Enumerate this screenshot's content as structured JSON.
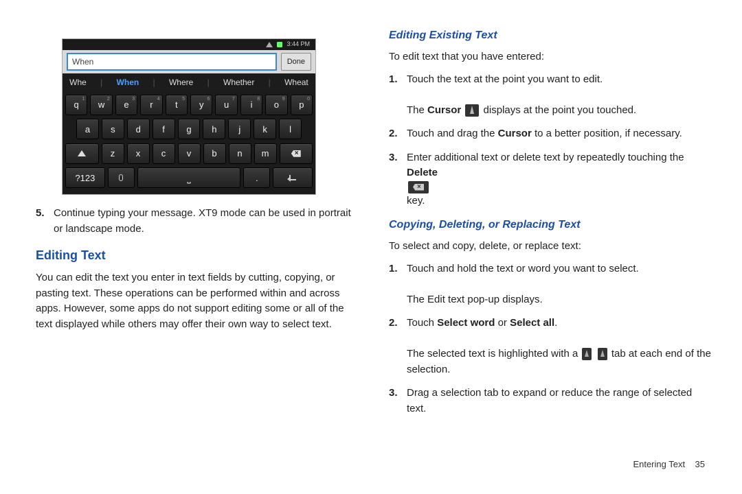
{
  "screenshot": {
    "status_time": "3:44 PM",
    "input_value": "When",
    "done_label": "Done",
    "suggestions": [
      "Whe",
      "When",
      "Where",
      "Whether",
      "Wheat"
    ],
    "active_suggestion_index": 1,
    "rows": {
      "r1": [
        {
          "k": "q",
          "s": "1"
        },
        {
          "k": "w",
          "s": "2"
        },
        {
          "k": "e",
          "s": "3"
        },
        {
          "k": "r",
          "s": "4"
        },
        {
          "k": "t",
          "s": "5"
        },
        {
          "k": "y",
          "s": "6"
        },
        {
          "k": "u",
          "s": "7"
        },
        {
          "k": "i",
          "s": "8"
        },
        {
          "k": "o",
          "s": "9"
        },
        {
          "k": "p",
          "s": "0"
        }
      ],
      "r2": [
        {
          "k": "a"
        },
        {
          "k": "s"
        },
        {
          "k": "d"
        },
        {
          "k": "f"
        },
        {
          "k": "g"
        },
        {
          "k": "h"
        },
        {
          "k": "j"
        },
        {
          "k": "k"
        },
        {
          "k": "l"
        }
      ],
      "r3_letters": [
        {
          "k": "z"
        },
        {
          "k": "x"
        },
        {
          "k": "c"
        },
        {
          "k": "v"
        },
        {
          "k": "b"
        },
        {
          "k": "n"
        },
        {
          "k": "m"
        }
      ],
      "sym_label": "?123",
      "period": "."
    }
  },
  "left": {
    "step5_num": "5.",
    "step5_text": "Continue typing your message. XT9 mode can be used in portrait or landscape mode.",
    "heading": "Editing Text",
    "para": "You can edit the text you enter in text fields by cutting, copying, or pasting text. These operations can be performed within and across apps. However, some apps do not support editing some or all of the text displayed while others may offer their own way to select text."
  },
  "right": {
    "sec1_heading": "Editing Existing Text",
    "sec1_intro": "To edit text that you have entered:",
    "sec1_step1_num": "1.",
    "sec1_step1_text": "Touch the text at the point you want to edit.",
    "sec1_step1_note_a": "The ",
    "sec1_step1_note_b": "Cursor",
    "sec1_step1_note_c": " displays at the point you touched.",
    "sec1_step2_num": "2.",
    "sec1_step2_a": "Touch and drag the ",
    "sec1_step2_b": "Cursor",
    "sec1_step2_c": " to a better position, if necessary.",
    "sec1_step3_num": "3.",
    "sec1_step3_a": "Enter additional text or delete text by repeatedly touching the ",
    "sec1_step3_b": "Delete",
    "sec1_step3_c": " key.",
    "sec2_heading": "Copying, Deleting, or Replacing Text",
    "sec2_intro": "To select and copy, delete, or replace text:",
    "sec2_step1_num": "1.",
    "sec2_step1_text": "Touch and hold the text or word you want to select.",
    "sec2_step1_note": "The Edit text pop-up displays.",
    "sec2_step2_num": "2.",
    "sec2_step2_a": "Touch ",
    "sec2_step2_b": "Select word",
    "sec2_step2_c": " or ",
    "sec2_step2_d": "Select all",
    "sec2_step2_e": ".",
    "sec2_step2_note_a": "The selected text is highlighted with a ",
    "sec2_step2_note_b": " tab at each end of the selection.",
    "sec2_step3_num": "3.",
    "sec2_step3_text": "Drag a selection tab to expand or reduce the range of selected text."
  },
  "footer": {
    "section": "Entering Text",
    "page": "35"
  }
}
